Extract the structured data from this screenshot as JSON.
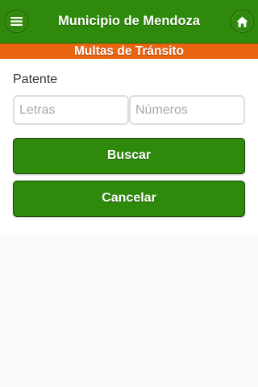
{
  "header": {
    "title": "Municipio de Mendoza",
    "menu_icon": "menu-icon",
    "home_icon": "home-icon"
  },
  "subheader": {
    "title": "Multas de Tránsito"
  },
  "form": {
    "patente_label": "Patente",
    "letras_placeholder": "Letras",
    "letras_value": "",
    "numeros_placeholder": "Números",
    "numeros_value": "",
    "buscar_label": "Buscar",
    "cancelar_label": "Cancelar"
  },
  "colors": {
    "header_green": "#2f8a0c",
    "subheader_orange": "#ea6412",
    "page_background": "#f9f9f9"
  }
}
